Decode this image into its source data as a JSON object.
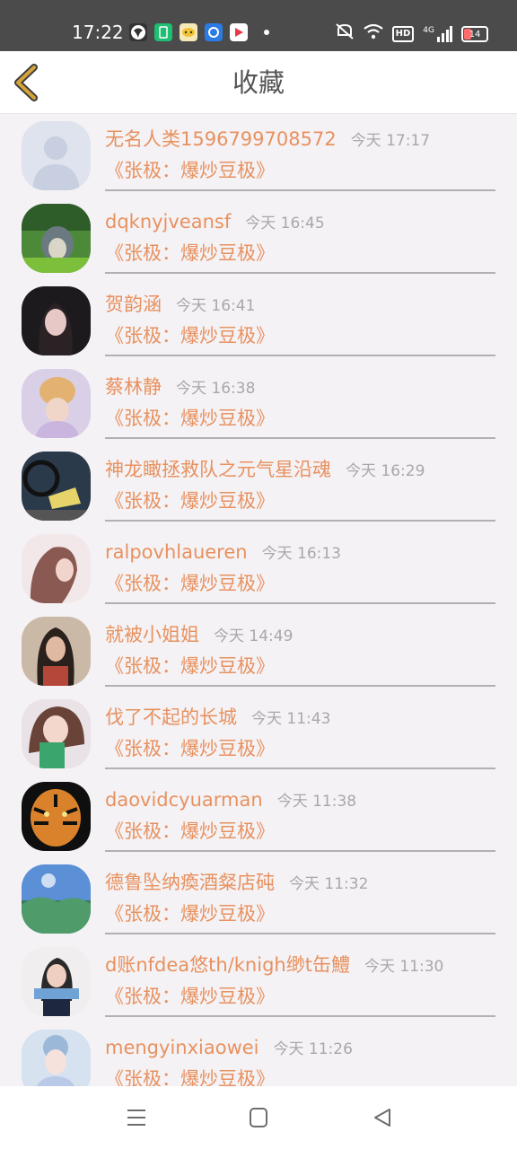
{
  "status_bar": {
    "time": "17:22",
    "battery": "14",
    "signal_label": "4G",
    "hd_label": "HD",
    "icons": [
      "app-icon-1",
      "app-icon-2",
      "app-icon-3",
      "app-icon-4",
      "app-icon-5",
      "mute-icon",
      "wifi-icon",
      "signal-icon",
      "battery-icon"
    ]
  },
  "header": {
    "title": "收藏",
    "back_icon": "chevron-left-icon"
  },
  "colors": {
    "accent": "#e8915f",
    "timestamp": "#a9a7aa",
    "back": "#c99a2e"
  },
  "items": [
    {
      "name": "无名人类1596799708572",
      "time": "今天 17:17",
      "book": "《张极：爆炒豆极》"
    },
    {
      "name": "dqknyjveansf",
      "time": "今天 16:45",
      "book": "《张极：爆炒豆极》"
    },
    {
      "name": "贺韵涵",
      "time": "今天 16:41",
      "book": "《张极：爆炒豆极》"
    },
    {
      "name": "蔡林静",
      "time": "今天 16:38",
      "book": "《张极：爆炒豆极》"
    },
    {
      "name": "神龙瞰拯救队之元气星沿魂",
      "time": "今天 16:29",
      "book": "《张极：爆炒豆极》"
    },
    {
      "name": "ralpovhlaueren",
      "time": "今天 16:13",
      "book": "《张极：爆炒豆极》"
    },
    {
      "name": "就被小姐姐",
      "time": "今天 14:49",
      "book": "《张极：爆炒豆极》"
    },
    {
      "name": "伐了不起的长城",
      "time": "今天 11:43",
      "book": "《张极：爆炒豆极》"
    },
    {
      "name": "daovidcyuarman",
      "time": "今天 11:38",
      "book": "《张极：爆炒豆极》"
    },
    {
      "name": "德鲁坠纳瘓酒粲店砘",
      "time": "今天 11:32",
      "book": "《张极：爆炒豆极》"
    },
    {
      "name": "d账nfdea悠th/knigh缈t缶鱧",
      "time": "今天 11:30",
      "book": "《张极：爆炒豆极》"
    },
    {
      "name": "mengyinxiaowei",
      "time": "今天 11:26",
      "book": "《张极：爆炒豆极》"
    }
  ],
  "nav": {
    "menu_icon": "menu-icon",
    "home_icon": "home-square-icon",
    "back_icon": "back-triangle-icon"
  }
}
